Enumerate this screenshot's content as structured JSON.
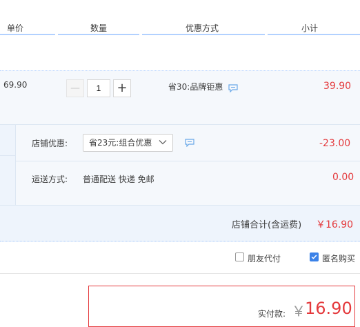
{
  "header": {
    "col_price": "单价",
    "col_qty": "数量",
    "col_promo": "优惠方式",
    "col_subtotal": "小计"
  },
  "item": {
    "unit_price": "69.90",
    "quantity": "1",
    "minus_label": "—",
    "plus_label": "+",
    "promo": "省30:品牌钜惠",
    "subtotal": "39.90"
  },
  "shop": {
    "discount_label": "店铺优惠:",
    "discount_select": "省23元:组合优惠",
    "discount_value": "-23.00",
    "shipping_label": "运送方式:",
    "shipping_method": "普通配送 快递 免邮",
    "shipping_value": "0.00",
    "total_label": "店铺合计(含运费)",
    "total_value": "￥16.90"
  },
  "options": {
    "friend_pay": "朋友代付",
    "friend_pay_checked": false,
    "anonymous": "匿名购买",
    "anonymous_checked": true
  },
  "payment": {
    "label": "实付款:",
    "currency": "￥",
    "amount": "16.90"
  },
  "colors": {
    "accent_red": "#e4393c",
    "header_line": "#b2d1ff",
    "checkbox_blue": "#3b82e8"
  }
}
